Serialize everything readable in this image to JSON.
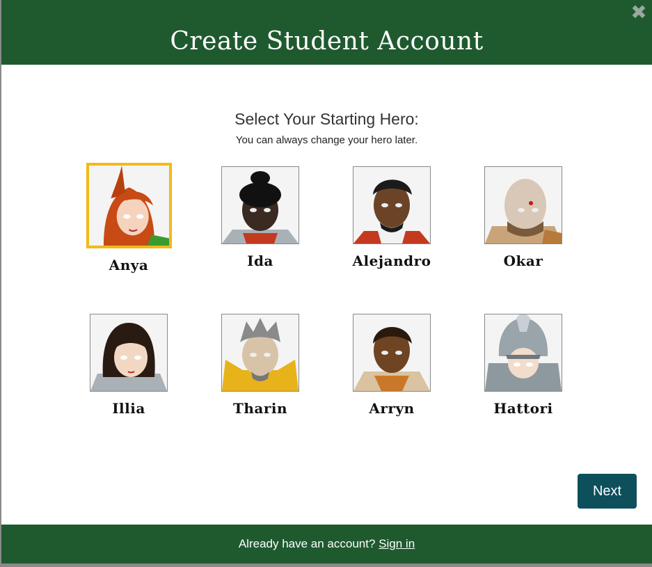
{
  "modal": {
    "title": "Create Student Account",
    "close_icon": "close-icon"
  },
  "heroes": {
    "heading": "Select Your Starting Hero:",
    "subheading": "You can always change your hero later.",
    "selected": "Anya",
    "items": [
      {
        "name": "Anya",
        "skin": "#f6d3bd",
        "hair": "#c84a14"
      },
      {
        "name": "Ida",
        "skin": "#3a2a22",
        "hair": "#111111"
      },
      {
        "name": "Alejandro",
        "skin": "#6b4428",
        "hair": "#1b1b1b"
      },
      {
        "name": "Okar",
        "skin": "#d9c7b7",
        "hair": "#d9c7b7"
      },
      {
        "name": "Illia",
        "skin": "#f2d8c2",
        "hair": "#2a1b12"
      },
      {
        "name": "Tharin",
        "skin": "#d8c3a8",
        "hair": "#8a8a8a"
      },
      {
        "name": "Arryn",
        "skin": "#6e4423",
        "hair": "#2a1a0e"
      },
      {
        "name": "Hattori",
        "skin": "#f2dccb",
        "hair": "#9aa4ab"
      }
    ]
  },
  "actions": {
    "next_label": "Next"
  },
  "footer": {
    "prompt": "Already have an account?",
    "sign_in_label": "Sign in"
  },
  "colors": {
    "header_green": "#1f5a2f",
    "selected_border": "#f2b918",
    "next_button": "#0e4f5c"
  }
}
